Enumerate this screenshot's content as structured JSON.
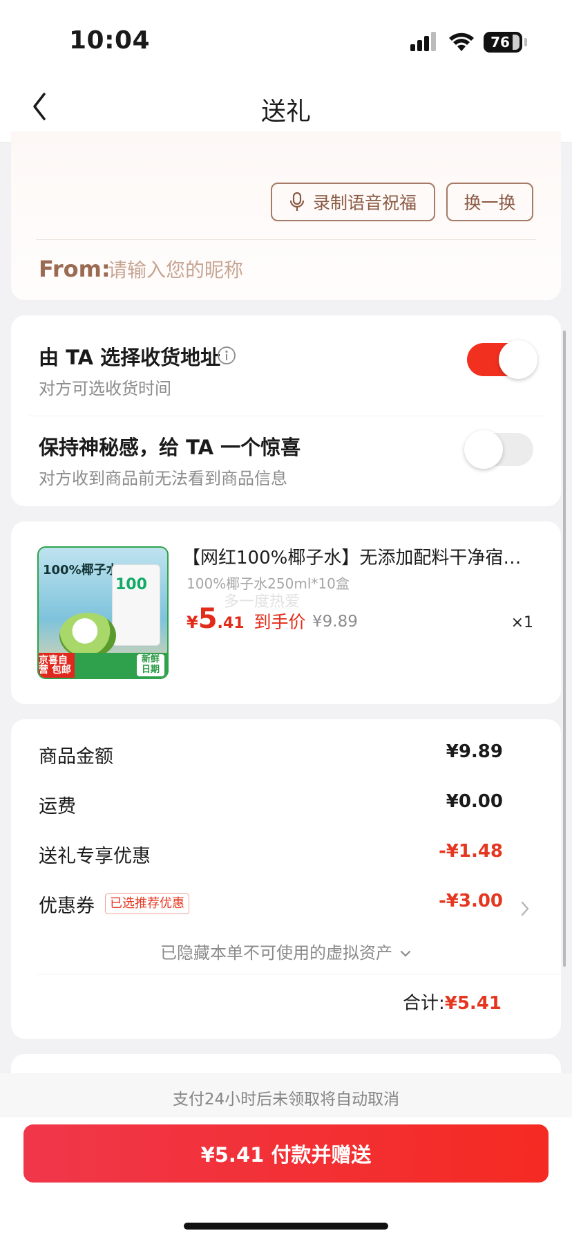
{
  "status_bar": {
    "time": "10:04",
    "battery": "76"
  },
  "nav": {
    "title": "送礼"
  },
  "wish": {
    "record_button": "录制语音祝福",
    "swap_button": "换一换",
    "from_label": "From:",
    "nickname_placeholder": "请输入您的昵称"
  },
  "options": [
    {
      "title": "由 TA 选择收货地址",
      "subtitle": "对方可选收货时间",
      "enabled": true
    },
    {
      "title": "保持神秘感，给 TA 一个惊喜",
      "subtitle": "对方收到商品前无法看到商品信息",
      "enabled": false
    }
  ],
  "product": {
    "title": "【网红100%椰子水】无添加配料干净宿…",
    "spec": "100%椰子水250ml*10盒",
    "watermark": "多一度热爱",
    "price_currency": "¥",
    "price_int": "5",
    "price_dec": ".41",
    "price_label": "到手价",
    "original_price": "¥9.89",
    "quantity": "×1",
    "thumbnail": {
      "title": "100%椰子水",
      "badge_big": "100",
      "badge_left": "京喜自营 包邮",
      "badge_right": "新鲜 日期"
    }
  },
  "summary": {
    "rows": [
      {
        "label": "商品金额",
        "value": "¥9.89"
      },
      {
        "label": "运费",
        "value": "¥0.00"
      },
      {
        "label": "送礼专享优惠",
        "value": "-¥1.48"
      },
      {
        "label": "优惠券",
        "value": "-¥3.00",
        "tag": "已选推荐优惠"
      }
    ],
    "hidden_assets": "已隐藏本单不可使用的虚拟资产",
    "total_label": "合计:",
    "total_value": "¥5.41"
  },
  "footer": {
    "note": "支付24小时后未领取将自动取消",
    "pay_button": "¥5.41 付款并赠送"
  },
  "colors": {
    "accent": "#f1301f",
    "price_red": "#e5361f",
    "brown": "#9a6a52"
  }
}
